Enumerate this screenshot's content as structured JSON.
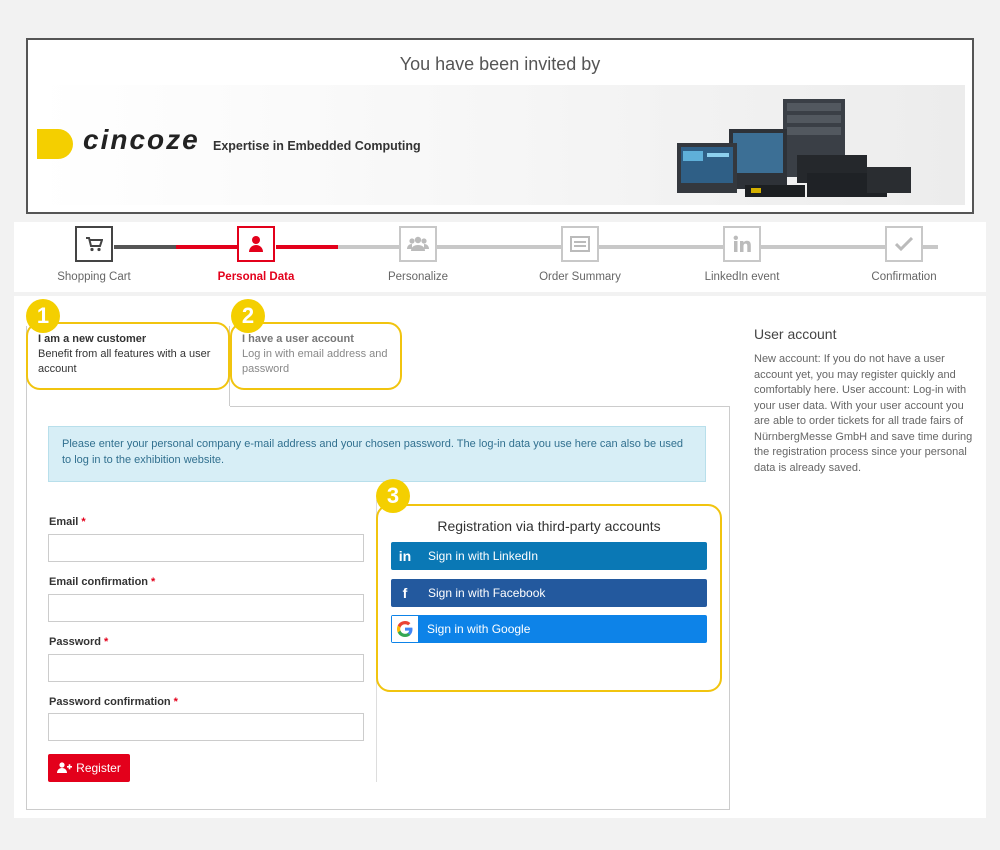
{
  "banner": {
    "invited_text": "You have been invited by",
    "brand_name": "cincoze",
    "brand_tagline": "Expertise in Embedded Computing"
  },
  "stepper": {
    "steps": [
      {
        "label": "Shopping Cart",
        "icon": "cart-icon",
        "state": "done"
      },
      {
        "label": "Personal Data",
        "icon": "user-icon",
        "state": "active"
      },
      {
        "label": "Personalize",
        "icon": "group-icon",
        "state": "pending"
      },
      {
        "label": "Order Summary",
        "icon": "list-icon",
        "state": "pending"
      },
      {
        "label": "LinkedIn event",
        "icon": "linkedin-icon",
        "state": "pending"
      },
      {
        "label": "Confirmation",
        "icon": "check-icon",
        "state": "pending"
      }
    ]
  },
  "tabs": {
    "new_customer": {
      "title": "I am a new customer",
      "desc": "Benefit from all features with a user account",
      "badge": "1"
    },
    "user_account": {
      "title": "I have a user account",
      "desc": "Log in with email address and password",
      "badge": "2"
    }
  },
  "info_text": "Please enter your personal company e-mail address and your chosen password. The log-in data you use here can also be used to log in to the exhibition website.",
  "form": {
    "email_label": "Email",
    "email_confirm_label": "Email confirmation",
    "password_label": "Password",
    "password_confirm_label": "Password confirmation",
    "required_mark": "*",
    "register_label": "Register"
  },
  "third_party": {
    "badge": "3",
    "title": "Registration via third-party accounts",
    "linkedin_label": "Sign in with LinkedIn",
    "facebook_label": "Sign in with Facebook",
    "google_label": "Sign in with Google"
  },
  "sidebar": {
    "title": "User account",
    "text": "New account: If you do not have a user account yet, you may register quickly and comfortably here. User account: Log-in with your user data. With your user account you are able to order tickets for all trade fairs of NürnbergMesse GmbH and save time during the registration process since your personal data is already saved."
  },
  "colors": {
    "accent_red": "#e3001b",
    "highlight_yellow": "#f4cf00",
    "linkedin_blue": "#0a78b5",
    "facebook_blue": "#23599e",
    "google_blue": "#0d83e8"
  }
}
